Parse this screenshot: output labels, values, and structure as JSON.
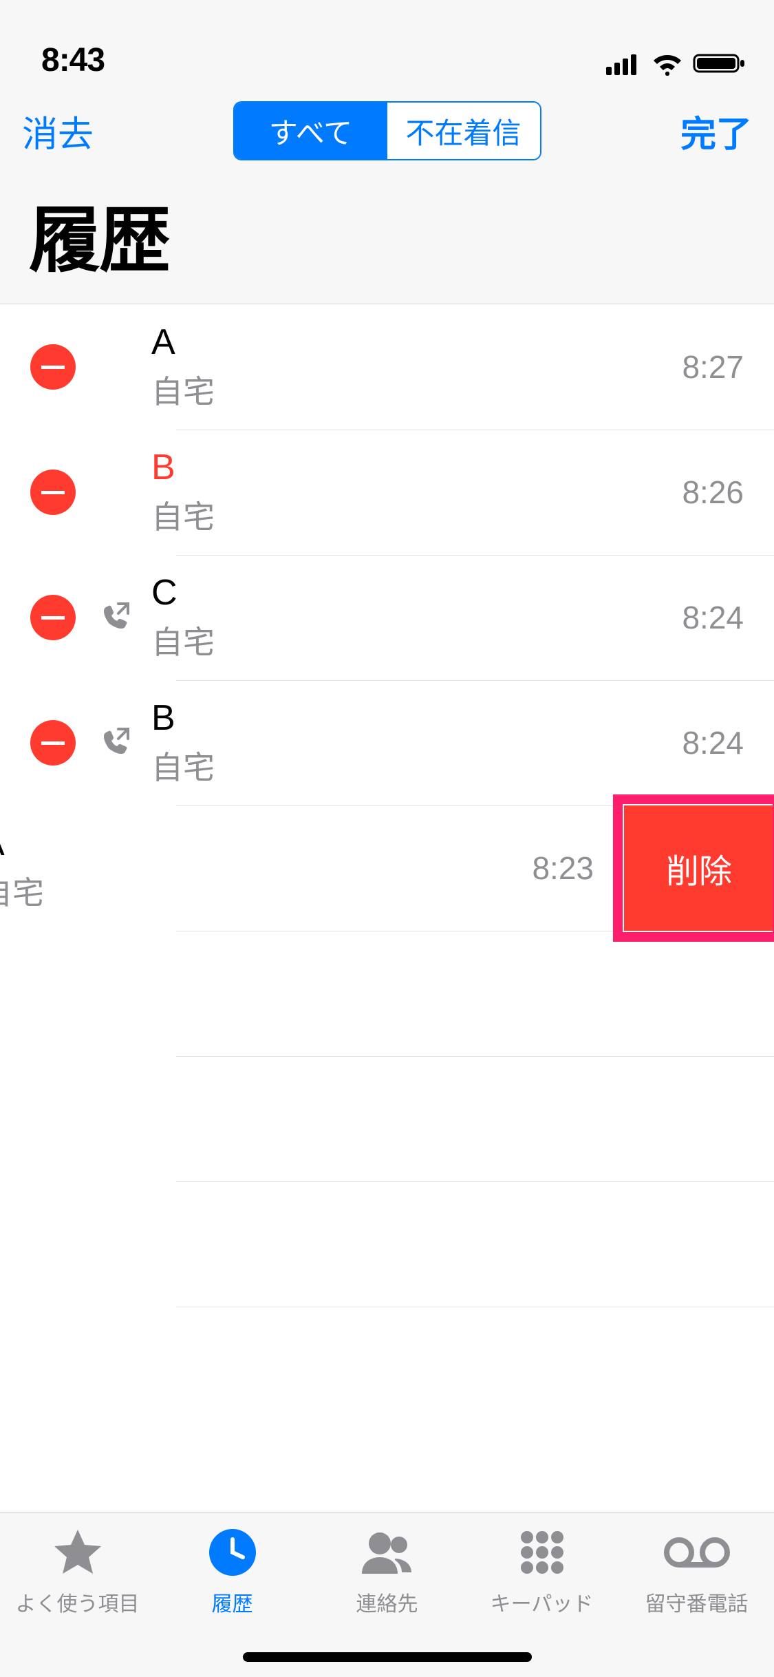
{
  "status": {
    "time": "8:43"
  },
  "nav": {
    "clear": "消去",
    "done": "完了",
    "seg_all": "すべて",
    "seg_missed": "不在着信"
  },
  "title": "履歴",
  "rows": [
    {
      "name": "A",
      "sub": "自宅",
      "time": "8:27",
      "missed": false,
      "outgoing": false
    },
    {
      "name": "B",
      "sub": "自宅",
      "time": "8:26",
      "missed": true,
      "outgoing": false
    },
    {
      "name": "C",
      "sub": "自宅",
      "time": "8:24",
      "missed": false,
      "outgoing": true
    },
    {
      "name": "B",
      "sub": "自宅",
      "time": "8:24",
      "missed": false,
      "outgoing": true
    },
    {
      "name": "A",
      "sub": "自宅",
      "time": "8:23",
      "missed": false,
      "outgoing": false,
      "slid": true
    }
  ],
  "delete_label": "削除",
  "tabs": {
    "favorites": "よく使う項目",
    "recents": "履歴",
    "contacts": "連絡先",
    "keypad": "キーパッド",
    "voicemail": "留守番電話"
  }
}
